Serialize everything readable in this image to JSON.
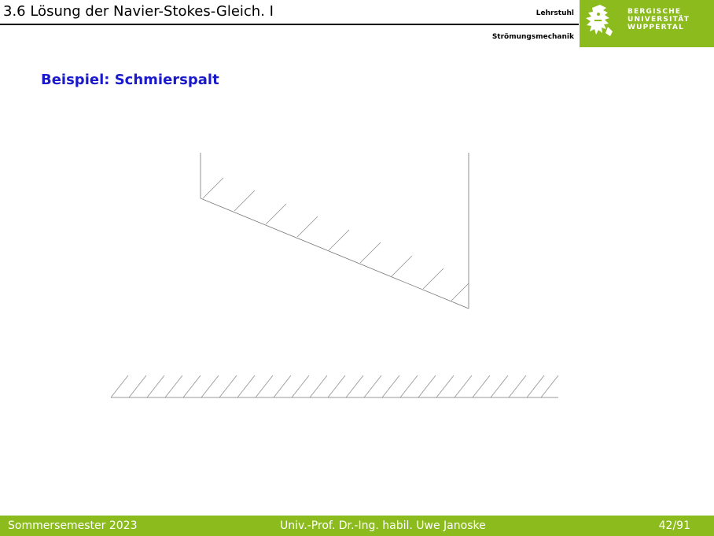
{
  "header": {
    "title": "3.6 Lösung der Navier-Stokes-Gleich. I",
    "chair_line1": "Lehrstuhl",
    "chair_line2": "Strömungsmechanik"
  },
  "logo": {
    "line1": "BERGISCHE",
    "line2": "UNIVERSITÄT",
    "line3": "WUPPERTAL",
    "emblem_icon": "university-lion-emblem-icon",
    "brand_color": "#8cbb1e"
  },
  "slide": {
    "heading": "Beispiel: Schmierspalt",
    "heading_color": "#1a1acc"
  },
  "footer": {
    "semester": "Sommersemester 2023",
    "author": "Univ.-Prof. Dr.-Ing. habil. Uwe Janoske",
    "page": "42/91"
  }
}
